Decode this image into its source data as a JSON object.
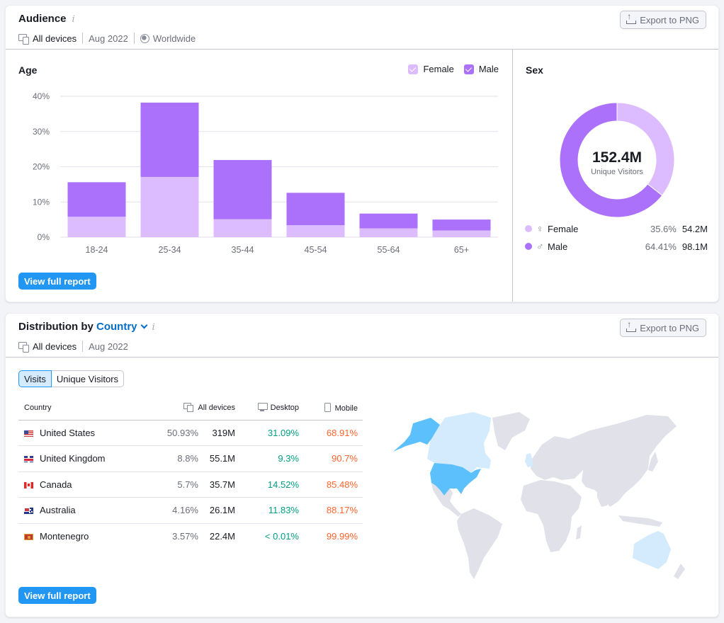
{
  "audience": {
    "title": "Audience",
    "info_icon": "i",
    "meta": {
      "devices": "All devices",
      "period": "Aug 2022",
      "region": "Worldwide"
    },
    "export_label": "Export to PNG",
    "age": {
      "title": "Age",
      "legend": [
        {
          "label": "Female",
          "color": "#dcbcff"
        },
        {
          "label": "Male",
          "color": "#ab71fa"
        }
      ]
    },
    "sex": {
      "title": "Sex",
      "total": "152.4M",
      "total_label": "Unique Visitors",
      "rows": [
        {
          "label": "Female",
          "symbol": "♀",
          "pct": "35.6%",
          "value": "54.2M",
          "color": "#dcbcff",
          "share": 35.59
        },
        {
          "label": "Male",
          "symbol": "♂",
          "pct": "64.41%",
          "value": "98.1M",
          "color": "#ab71fa",
          "share": 64.41
        }
      ]
    },
    "view_report_label": "View full report"
  },
  "chart_data": {
    "type": "bar",
    "stacked": true,
    "title": "Age",
    "xlabel": "",
    "ylabel": "",
    "categories": [
      "18-24",
      "25-34",
      "35-44",
      "45-54",
      "55-64",
      "65+"
    ],
    "series": [
      {
        "name": "Female",
        "color": "#dcbcff",
        "values": [
          5.8,
          17.1,
          5.1,
          3.4,
          2.5,
          1.9
        ]
      },
      {
        "name": "Male",
        "color": "#ab71fa",
        "values": [
          9.8,
          21.1,
          16.8,
          9.2,
          4.2,
          3.1
        ]
      }
    ],
    "ylim": [
      0,
      40
    ],
    "yticks": [
      "0%",
      "10%",
      "20%",
      "30%",
      "40%"
    ],
    "ytick_values": [
      0,
      10,
      20,
      30,
      40
    ],
    "grid": true,
    "legend": "top-right"
  },
  "distribution": {
    "title_prefix": "Distribution by",
    "title_link": "Country",
    "info_icon": "i",
    "meta": {
      "devices": "All devices",
      "period": "Aug 2022"
    },
    "export_label": "Export to PNG",
    "tabs": [
      {
        "label": "Visits",
        "active": true
      },
      {
        "label": "Unique Visitors",
        "active": false
      }
    ],
    "columns": {
      "country": "Country",
      "all": "All devices",
      "desktop": "Desktop",
      "mobile": "Mobile"
    },
    "rows": [
      {
        "flag": "us",
        "country": "United States",
        "share": "50.93%",
        "visits": "319M",
        "desktop": "31.09%",
        "mobile": "68.91%"
      },
      {
        "flag": "gb",
        "country": "United Kingdom",
        "share": "8.8%",
        "visits": "55.1M",
        "desktop": "9.3%",
        "mobile": "90.7%"
      },
      {
        "flag": "ca",
        "country": "Canada",
        "share": "5.7%",
        "visits": "35.7M",
        "desktop": "14.52%",
        "mobile": "85.48%"
      },
      {
        "flag": "au",
        "country": "Australia",
        "share": "4.16%",
        "visits": "26.1M",
        "desktop": "11.83%",
        "mobile": "88.17%"
      },
      {
        "flag": "me",
        "country": "Montenegro",
        "share": "3.57%",
        "visits": "22.4M",
        "desktop": "< 0.01%",
        "mobile": "99.99%"
      }
    ],
    "map_colors": {
      "high": "#5cc0fc",
      "low": "#d4ebfd",
      "none": "#e0e1e9"
    },
    "view_report_label": "View full report"
  }
}
